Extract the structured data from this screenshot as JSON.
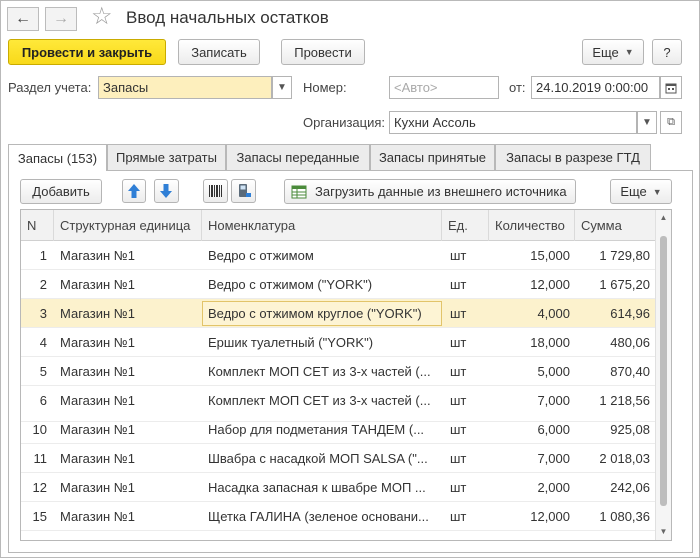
{
  "title": "Ввод начальных остатков",
  "nav": {
    "back": "←",
    "forward": "→",
    "star": "☆"
  },
  "toolbar": {
    "post_close": "Провести и закрыть",
    "save": "Записать",
    "post": "Провести",
    "more": "Еще",
    "help": "?"
  },
  "form": {
    "section_label": "Раздел учета:",
    "section_value": "Запасы",
    "number_label": "Номер:",
    "number_placeholder": "<Авто>",
    "from_label": "от:",
    "date_value": "24.10.2019  0:00:00",
    "org_label": "Организация:",
    "org_value": "Кухни Ассоль"
  },
  "tabs": [
    "Запасы (153)",
    "Прямые затраты",
    "Запасы переданные",
    "Запасы принятые",
    "Запасы в разрезе ГТД"
  ],
  "table_toolbar": {
    "add": "Добавить",
    "load": "Загрузить данные из внешнего источника",
    "more": "Еще"
  },
  "table": {
    "columns": [
      "N",
      "Структурная единица",
      "Номенклатура",
      "Ед.",
      "Количество",
      "Сумма"
    ],
    "rows": [
      {
        "n": "1",
        "unit": "Магазин №1",
        "item": "Ведро с отжимом",
        "uom": "шт",
        "qty": "15,000",
        "sum": "1 729,80"
      },
      {
        "n": "2",
        "unit": "Магазин №1",
        "item": "Ведро с отжимом (\"YORK\")",
        "uom": "шт",
        "qty": "12,000",
        "sum": "1 675,20"
      },
      {
        "n": "3",
        "unit": "Магазин №1",
        "item": "Ведро с отжимом  круглое (\"YORK\")",
        "uom": "шт",
        "qty": "4,000",
        "sum": "614,96"
      },
      {
        "n": "4",
        "unit": "Магазин №1",
        "item": "Ершик туалетный (\"YORK\")",
        "uom": "шт",
        "qty": "18,000",
        "sum": "480,06"
      },
      {
        "n": "5",
        "unit": "Магазин №1",
        "item": "Комплект МОП СЕТ из 3-х частей (...",
        "uom": "шт",
        "qty": "5,000",
        "sum": "870,40"
      },
      {
        "n": "6",
        "unit": "Магазин №1",
        "item": "Комплект МОП СЕТ из 3-х частей (...",
        "uom": "шт",
        "qty": "7,000",
        "sum": "1 218,56"
      },
      {
        "n": "10",
        "unit": "Магазин №1",
        "item": "Набор для подметания ТАНДЕМ (...",
        "uom": "шт",
        "qty": "6,000",
        "sum": "925,08"
      },
      {
        "n": "11",
        "unit": "Магазин №1",
        "item": "Швабра с насадкой МОП SALSA (\"...",
        "uom": "шт",
        "qty": "7,000",
        "sum": "2 018,03"
      },
      {
        "n": "12",
        "unit": "Магазин №1",
        "item": "Насадка запасная к швабре МОП ...",
        "uom": "шт",
        "qty": "2,000",
        "sum": "242,06"
      },
      {
        "n": "15",
        "unit": "Магазин №1",
        "item": "Щетка ГАЛИНА (зеленое основани...",
        "uom": "шт",
        "qty": "12,000",
        "sum": "1 080,36"
      }
    ]
  },
  "colors": {
    "primary_button": "#f8d91a",
    "selected_row": "#fcf2cd",
    "field_highlight": "#fdefbd",
    "arrow_blue": "#2f7fd6"
  }
}
